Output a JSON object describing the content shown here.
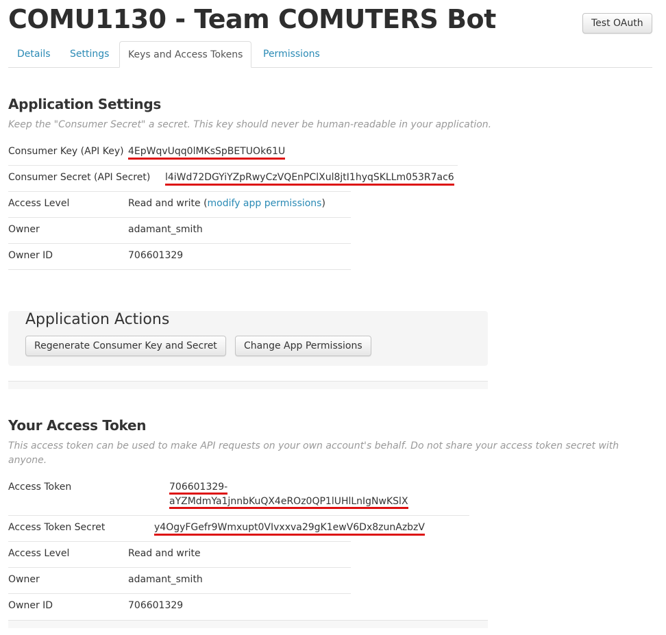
{
  "header": {
    "app_title": "COMU1130 - Team COMUTERS Bot",
    "test_oauth_label": "Test OAuth"
  },
  "tabs": [
    {
      "label": "Details",
      "active": false
    },
    {
      "label": "Settings",
      "active": false
    },
    {
      "label": "Keys and Access Tokens",
      "active": true
    },
    {
      "label": "Permissions",
      "active": false
    }
  ],
  "app_settings": {
    "title": "Application Settings",
    "hint": "Keep the \"Consumer Secret\" a secret. This key should never be human-readable in your application.",
    "consumer_key_label": "Consumer Key (API Key)",
    "consumer_key_value": "4EpWqvUqq0lMKsSpBETUOk61U",
    "consumer_secret_label": "Consumer Secret (API Secret)",
    "consumer_secret_value": "l4iWd72DGYiYZpRwyCzVQEnPClXul8jtI1hyqSKLLm053R7ac6",
    "access_level_label": "Access Level",
    "access_level_value": "Read and write (",
    "access_level_link": "modify app permissions",
    "access_level_suffix": ")",
    "owner_label": "Owner",
    "owner_value": "adamant_smith",
    "owner_id_label": "Owner ID",
    "owner_id_value": "706601329"
  },
  "app_actions": {
    "title": "Application Actions",
    "regenerate_label": "Regenerate Consumer Key and Secret",
    "change_permissions_label": "Change App Permissions"
  },
  "access_token": {
    "title": "Your Access Token",
    "hint": "This access token can be used to make API requests on your own account's behalf. Do not share your access token secret with anyone.",
    "token_label": "Access Token",
    "token_value_line1": "706601329-",
    "token_value_line2": "aYZMdmYa1jnnbKuQX4eROz0QP1lUHlLnIgNwKSlX",
    "token_secret_label": "Access Token Secret",
    "token_secret_value": "y4OgyFGefr9Wmxupt0VIvxxva29gK1ewV6Dx8zunAzbzV",
    "access_level_label": "Access Level",
    "access_level_value": "Read and write",
    "owner_label": "Owner",
    "owner_value": "adamant_smith",
    "owner_id_label": "Owner ID",
    "owner_id_value": "706601329"
  },
  "colors": {
    "link": "#2a8ab5",
    "highlight_underline": "#dd1111",
    "hint_text": "#999999"
  }
}
